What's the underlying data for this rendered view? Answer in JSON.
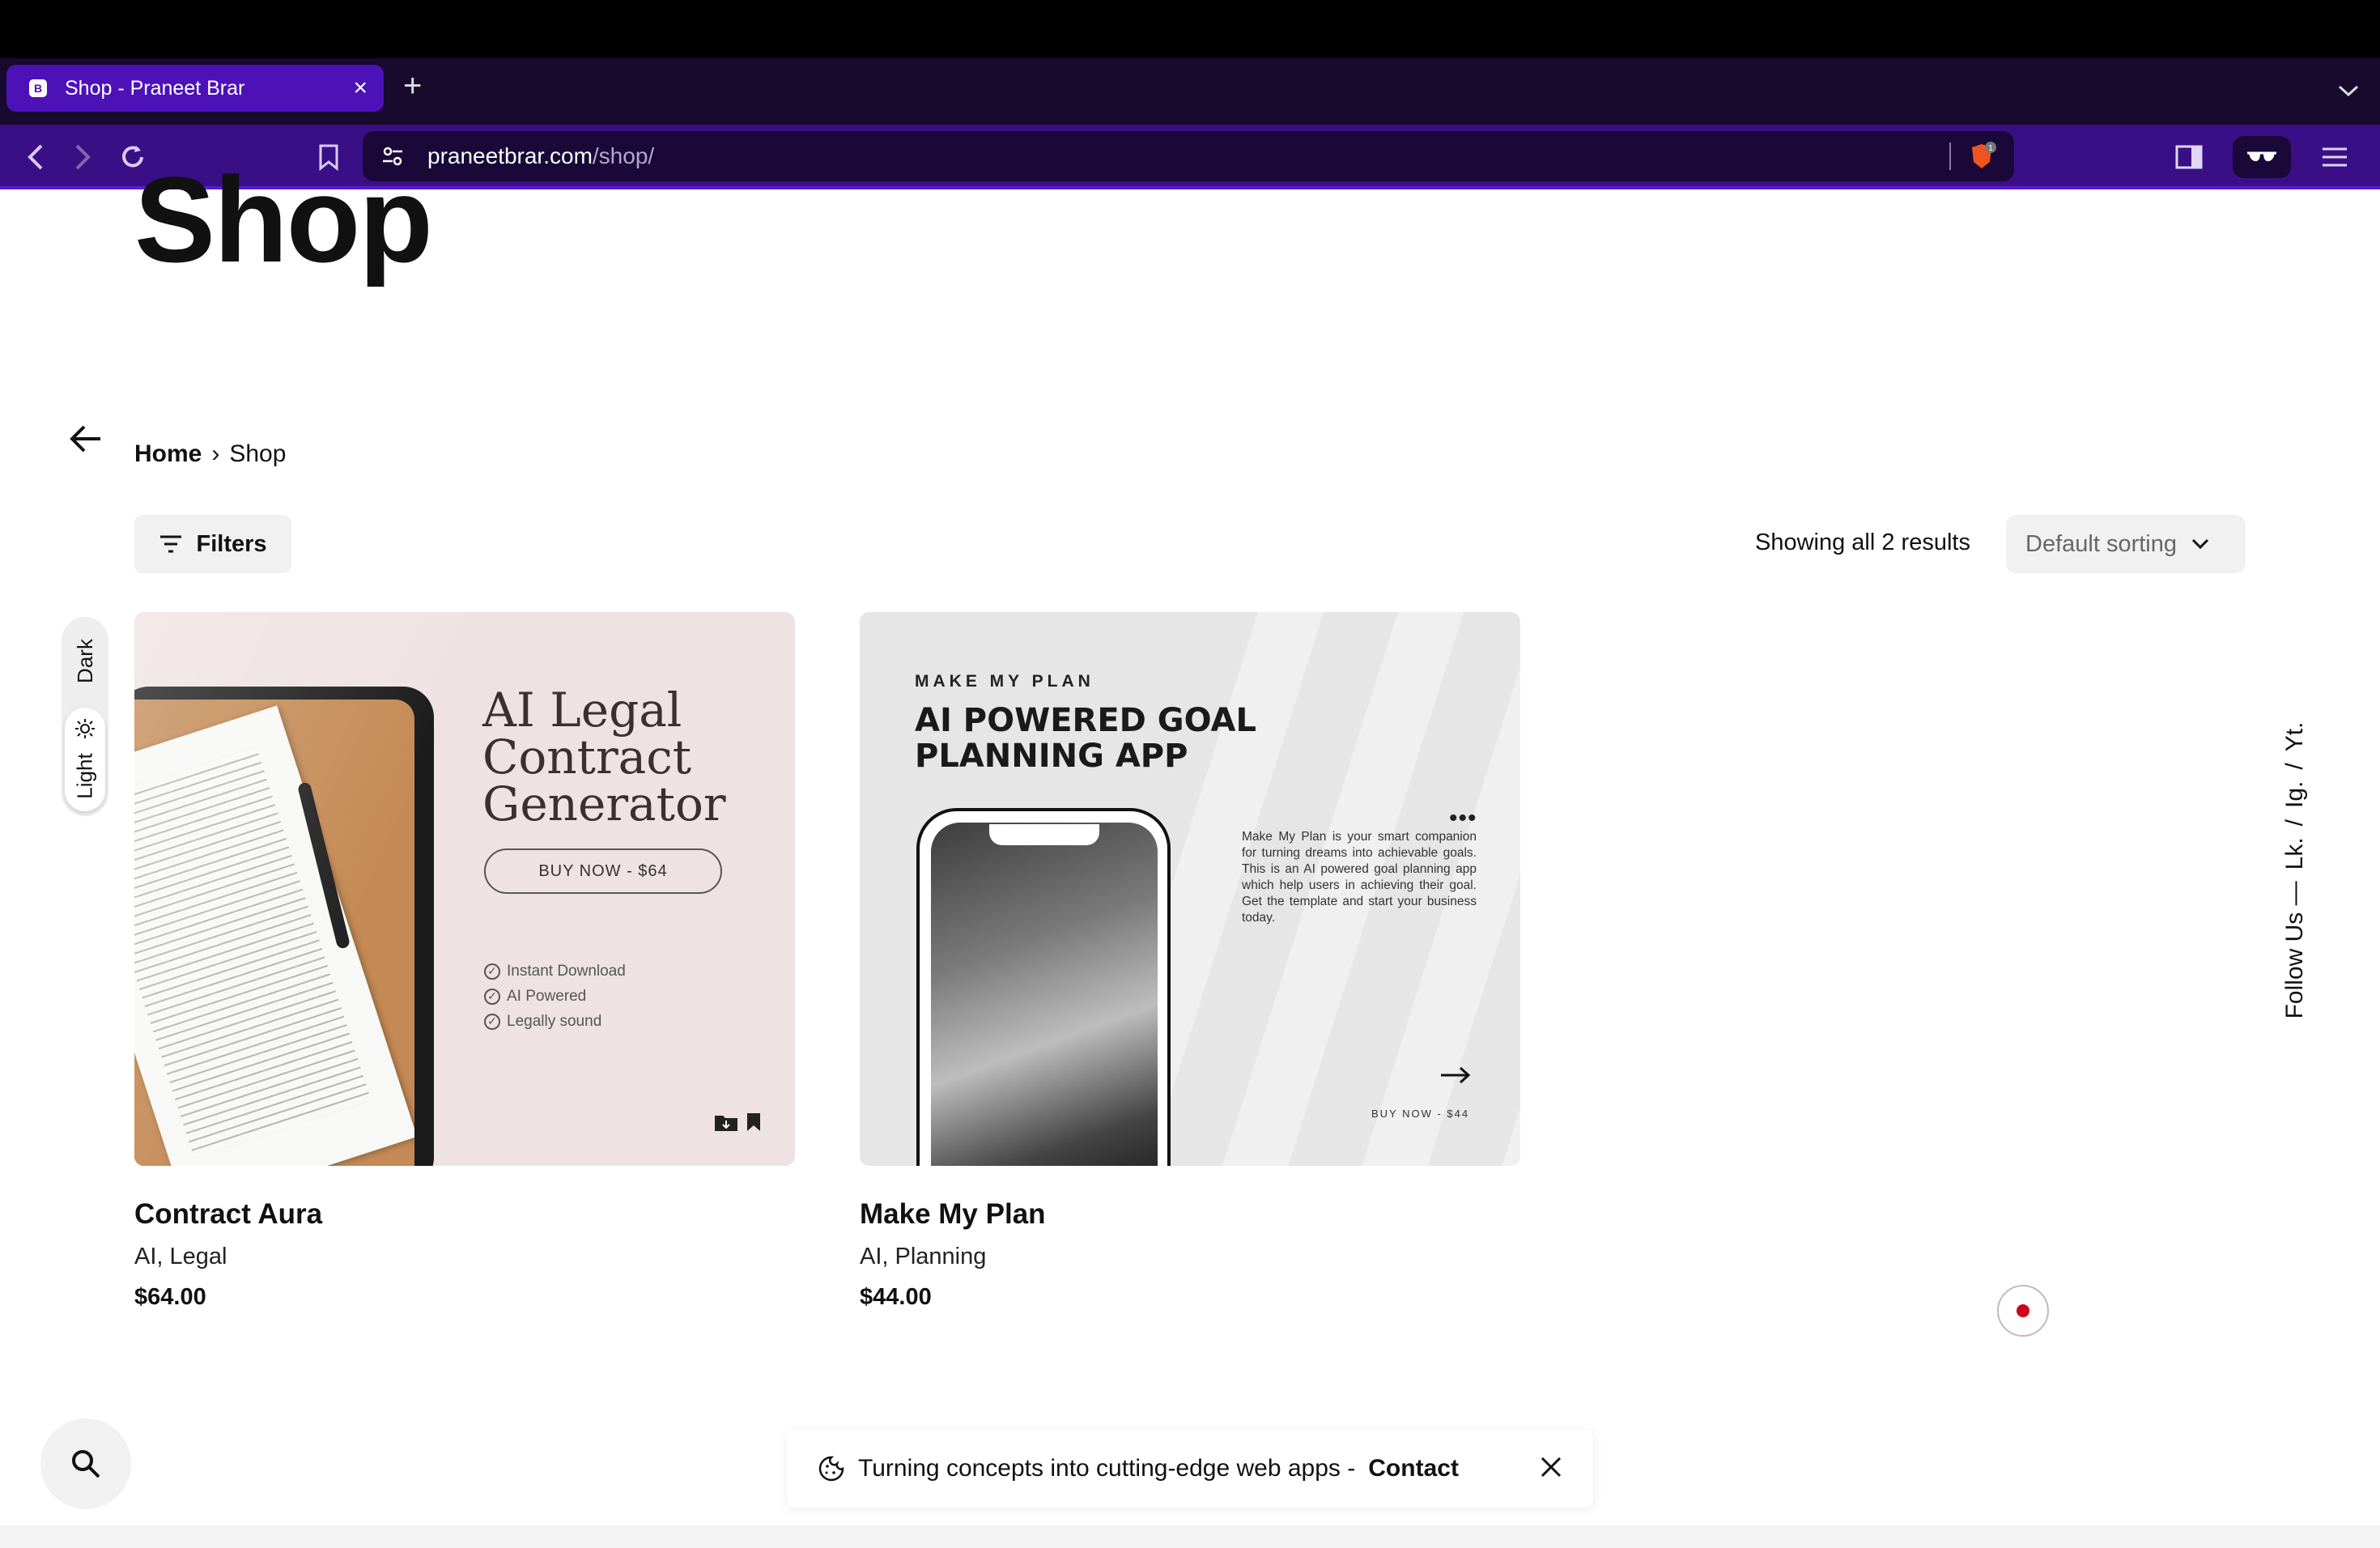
{
  "browser": {
    "tab_title": "Shop - Praneet Brar",
    "url_host": "praneetbrar.com",
    "url_path": "/shop/",
    "shield_count": "1"
  },
  "page": {
    "title": "Shop",
    "breadcrumb": {
      "home": "Home",
      "separator": "›",
      "current": "Shop"
    },
    "filters_label": "Filters",
    "results_text": "Showing all 2 results",
    "sort_label": "Default sorting",
    "theme": {
      "dark": "Dark",
      "light": "Light"
    }
  },
  "products": [
    {
      "name": "Contract Aura",
      "categories": "AI, Legal",
      "price": "$64.00",
      "image": {
        "title_lines": [
          "AI Legal",
          "Contract",
          "Generator"
        ],
        "buy_label": "BUY NOW - $64",
        "features": [
          "Instant Download",
          "AI Powered",
          "Legally sound"
        ]
      }
    },
    {
      "name": "Make My Plan",
      "categories": "AI, Planning",
      "price": "$44.00",
      "image": {
        "kicker": "MAKE MY PLAN",
        "title_lines": [
          "AI POWERED GOAL",
          "PLANNING APP"
        ],
        "description": "Make My Plan is your smart companion for turning dreams into achievable goals. This is an AI powered goal planning app which help users in achieving their goal. Get the template and start your business today.",
        "buy_label": "BUY NOW - $44"
      }
    }
  ],
  "follow": {
    "label": "Follow Us —",
    "links": [
      "Lk.",
      "/",
      "Ig.",
      "/",
      "Yt."
    ]
  },
  "toast": {
    "text": "Turning concepts into cutting-edge web apps -",
    "link": "Contact"
  }
}
